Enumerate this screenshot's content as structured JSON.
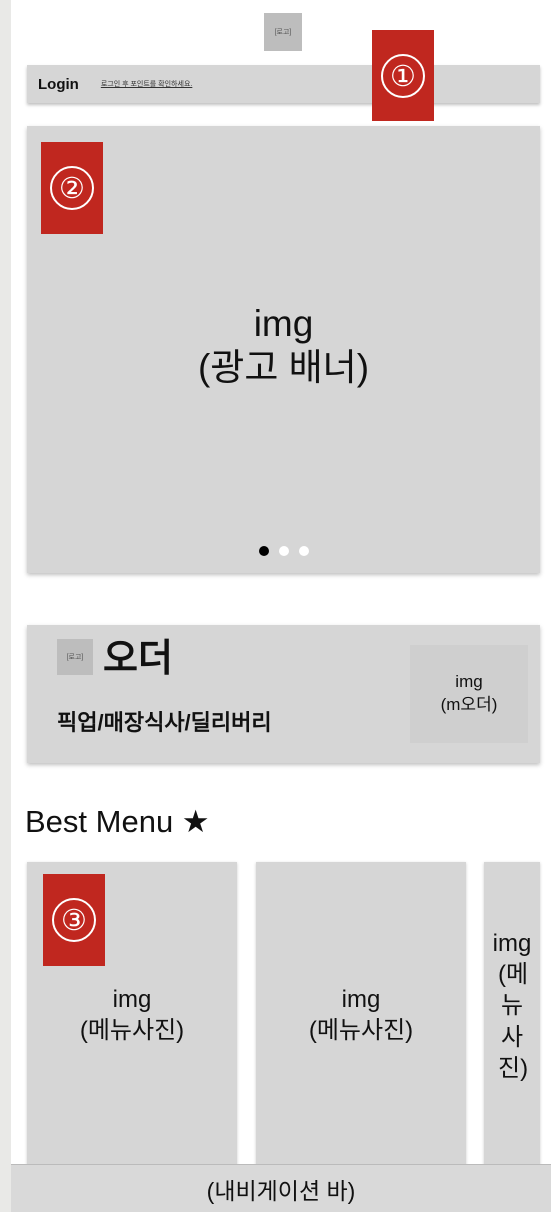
{
  "header": {
    "logo_label": "[로고]"
  },
  "login_bar": {
    "title": "Login",
    "hint": "로그인 후 포인트를 확인하세요."
  },
  "markers": [
    "①",
    "②",
    "③"
  ],
  "banner": {
    "line1": "img",
    "line2": "(광고 배너)",
    "page_count": 3,
    "active_page": 1
  },
  "order_card": {
    "logo_label": "[로고]",
    "title": "오더",
    "subtitle": "픽업/매장식사/딜리버리",
    "img_line1": "img",
    "img_line2": "(m오더)"
  },
  "best_menu": {
    "title": "Best Menu ★",
    "items": [
      {
        "line1": "img",
        "line2": "(메뉴사진)"
      },
      {
        "line1": "img",
        "line2": "(메뉴사진)"
      },
      {
        "line1": "img",
        "line2": "(메뉴사진)"
      }
    ]
  },
  "navbar": {
    "label": "(내비게이션 바)"
  },
  "colors": {
    "marker": "#c0271f",
    "placeholder": "#d6d6d6",
    "background": "#ffffff"
  }
}
